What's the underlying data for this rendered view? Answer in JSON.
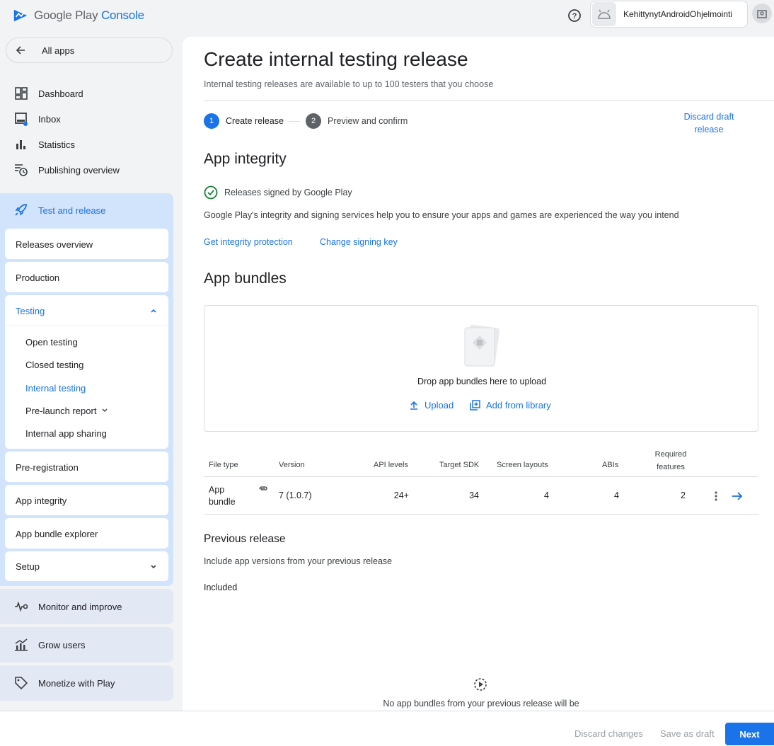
{
  "header": {
    "logo_google_play": "Google Play",
    "logo_console": "Console",
    "account_name": "KehittynytAndroidOhjelmointi"
  },
  "sidebar": {
    "all_apps": "All apps",
    "items": [
      {
        "label": "Dashboard",
        "icon": "dashboard-icon"
      },
      {
        "label": "Inbox",
        "icon": "inbox-icon"
      },
      {
        "label": "Statistics",
        "icon": "bar-chart-icon"
      },
      {
        "label": "Publishing overview",
        "icon": "publishing-icon"
      }
    ],
    "test_and_release": {
      "label": "Test and release",
      "sub": {
        "releases_overview": "Releases overview",
        "production": "Production",
        "testing": "Testing",
        "testing_items": [
          "Open testing",
          "Closed testing",
          "Internal testing",
          "Pre-launch report",
          "Internal app sharing"
        ],
        "pre_registration": "Pre-registration",
        "app_integrity": "App integrity",
        "app_bundle_explorer": "App bundle explorer",
        "setup": "Setup"
      }
    },
    "monitor": "Monitor and improve",
    "grow": "Grow users",
    "monetize": "Monetize with Play"
  },
  "main": {
    "title": "Create internal testing release",
    "subtitle": "Internal testing releases are available to up to 100 testers that you choose",
    "steps": [
      {
        "num": "1",
        "label": "Create release"
      },
      {
        "num": "2",
        "label": "Preview and confirm"
      }
    ],
    "discard_draft": "Discard draft release",
    "app_integrity": {
      "heading": "App integrity",
      "signed": "Releases signed by Google Play",
      "description": "Google Play's integrity and signing services help you to ensure your apps and games are experienced the way you intend",
      "link_protection": "Get integrity protection",
      "link_signing": "Change signing key"
    },
    "app_bundles": {
      "heading": "App bundles",
      "drop_text": "Drop app bundles here to upload",
      "upload": "Upload",
      "add_from_library": "Add from library"
    },
    "table": {
      "headers": {
        "file_type": "File type",
        "version": "Version",
        "api_levels": "API levels",
        "target_sdk": "Target SDK",
        "screen_layouts": "Screen layouts",
        "abis": "ABIs",
        "required_features": "Required features"
      },
      "row": {
        "file_type": "App bundle",
        "version": "7 (1.0.7)",
        "api_levels": "24+",
        "target_sdk": "34",
        "screen_layouts": "4",
        "abis": "4",
        "required_features": "2"
      }
    },
    "previous_release": {
      "heading": "Previous release",
      "description": "Include app versions from your previous release",
      "included": "Included",
      "none_text": "No app bundles from your previous release will be"
    }
  },
  "footer": {
    "discard_changes": "Discard changes",
    "save_as_draft": "Save as draft",
    "next": "Next"
  },
  "colors": {
    "accent": "#1a73e8",
    "success": "#188038",
    "sidebar_active": "#d2e3fc"
  }
}
